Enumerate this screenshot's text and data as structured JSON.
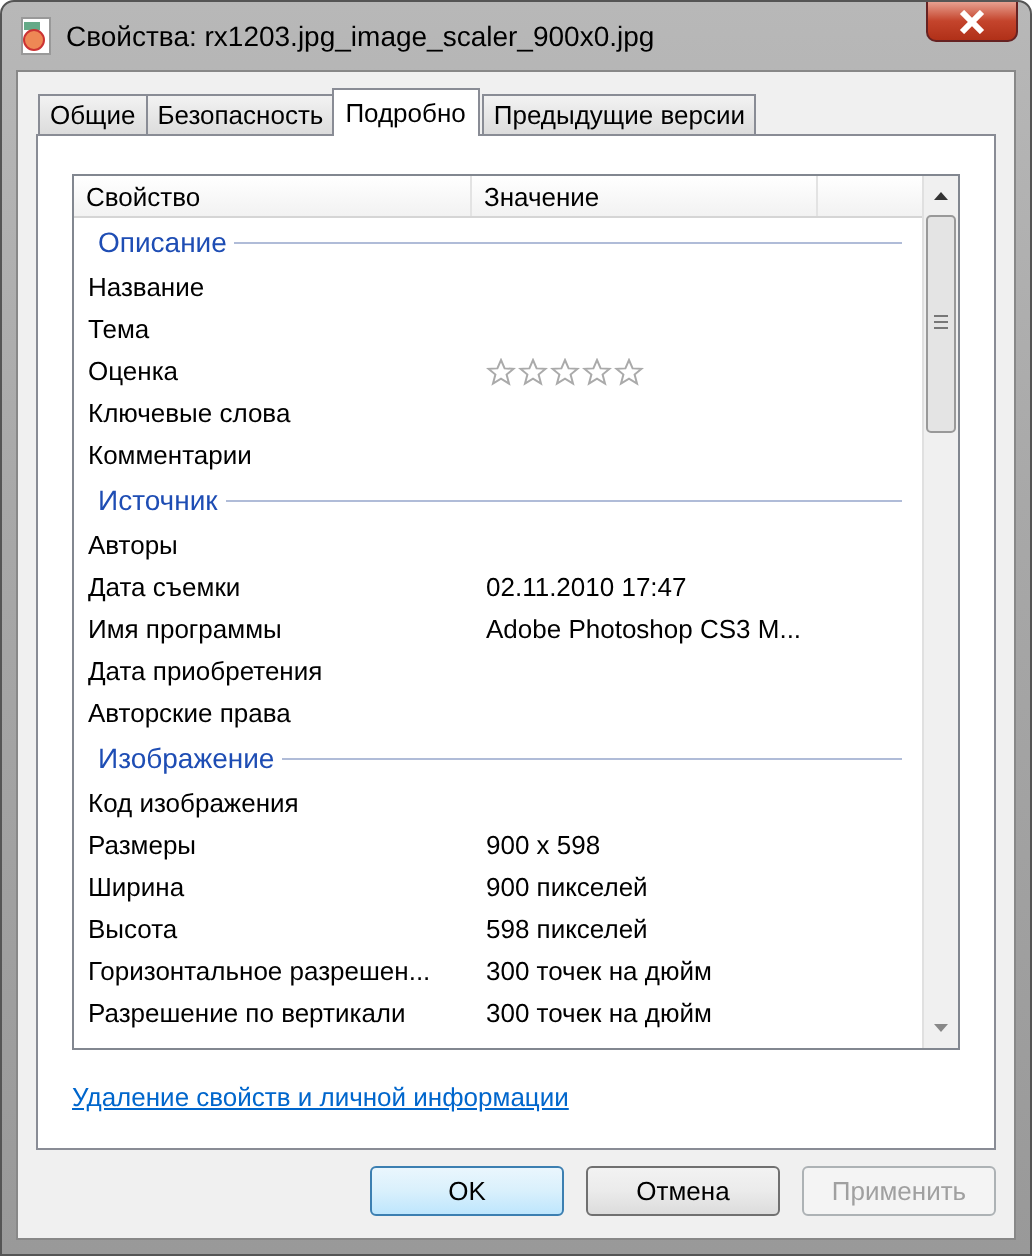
{
  "window": {
    "title": "Свойства: rx1203.jpg_image_scaler_900x0.jpg"
  },
  "tabs": [
    {
      "label": "Общие",
      "selected": false
    },
    {
      "label": "Безопасность",
      "selected": false
    },
    {
      "label": "Подробно",
      "selected": true
    },
    {
      "label": "Предыдущие версии",
      "selected": false
    }
  ],
  "table": {
    "columns": [
      "Свойство",
      "Значение"
    ],
    "groups": [
      {
        "title": "Описание",
        "rows": [
          {
            "kind": "text",
            "name": "Название"
          },
          {
            "kind": "text",
            "name": "Тема"
          },
          {
            "kind": "rating",
            "name": "Оценка",
            "stars": 0
          },
          {
            "kind": "text",
            "name": "Ключевые слова"
          },
          {
            "kind": "text",
            "name": "Комментарии"
          }
        ]
      },
      {
        "title": "Источник",
        "rows": [
          {
            "kind": "text",
            "name": "Авторы"
          },
          {
            "kind": "text",
            "name": "Дата съемки",
            "value": "02.11.2010 17:47"
          },
          {
            "kind": "text",
            "name": "Имя программы",
            "value": "Adobe Photoshop CS3 M..."
          },
          {
            "kind": "text",
            "name": "Дата приобретения"
          },
          {
            "kind": "text",
            "name": "Авторские права"
          }
        ]
      },
      {
        "title": "Изображение",
        "rows": [
          {
            "kind": "text",
            "name": "Код изображения"
          },
          {
            "kind": "text",
            "name": "Размеры",
            "value": "900 x 598"
          },
          {
            "kind": "text",
            "name": "Ширина",
            "value": "900 пикселей"
          },
          {
            "kind": "text",
            "name": "Высота",
            "value": "598 пикселей"
          },
          {
            "kind": "text",
            "name": "Горизонтальное разрешен...",
            "value": "300 точек на дюйм"
          },
          {
            "kind": "text",
            "name": "Разрешение по вертикали",
            "value": "300 точек на дюйм"
          }
        ]
      }
    ]
  },
  "link": "Удаление свойств и личной информации",
  "buttons": [
    {
      "label": "OK",
      "kind": "default",
      "disabled": false
    },
    {
      "label": "Отмена",
      "kind": "normal",
      "disabled": false
    },
    {
      "label": "Применить",
      "kind": "normal",
      "disabled": true
    }
  ]
}
